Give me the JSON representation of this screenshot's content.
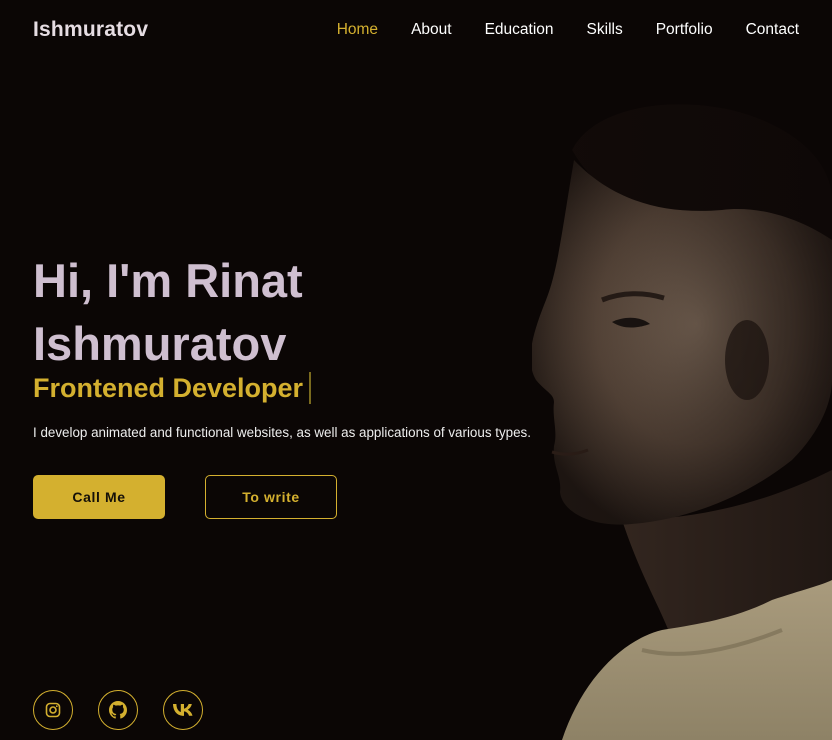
{
  "header": {
    "logo": "Ishmuratov",
    "nav": [
      {
        "label": "Home",
        "active": true
      },
      {
        "label": "About",
        "active": false
      },
      {
        "label": "Education",
        "active": false
      },
      {
        "label": "Skills",
        "active": false
      },
      {
        "label": "Portfolio",
        "active": false
      },
      {
        "label": "Contact",
        "active": false
      }
    ]
  },
  "hero": {
    "title_line1": "Hi, I'm Rinat",
    "title_line2": "Ishmuratov",
    "subtitle": "Frontened Developer",
    "description": "I develop animated and functional websites, as well as applications of various types.",
    "primary_button": "Call Me",
    "secondary_button": "To write"
  },
  "socials": [
    {
      "icon": "instagram-icon"
    },
    {
      "icon": "github-icon"
    },
    {
      "icon": "vk-icon"
    }
  ],
  "colors": {
    "background": "#0b0605",
    "accent": "#d4b02f",
    "title": "#cfbfd0",
    "nav_text": "#ffffff"
  }
}
